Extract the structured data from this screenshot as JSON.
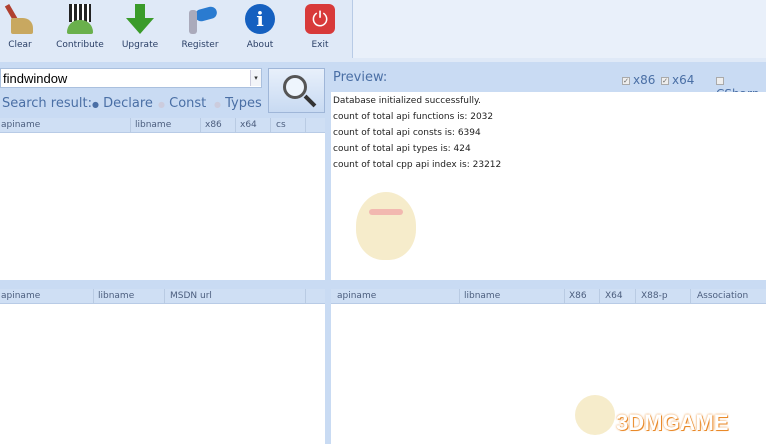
{
  "toolbar": {
    "buttons": [
      {
        "label": "Clear",
        "icon": "broom-icon"
      },
      {
        "label": "Contribute",
        "icon": "qr-android-icon"
      },
      {
        "label": "Upgrate",
        "icon": "download-arrow-icon"
      },
      {
        "label": "Register",
        "icon": "key-icon"
      },
      {
        "label": "About",
        "icon": "info-icon"
      },
      {
        "label": "Exit",
        "icon": "power-icon"
      }
    ]
  },
  "search": {
    "value": "findwindow",
    "result_label": "Search result:",
    "options": [
      "Declare",
      "Const",
      "Types"
    ],
    "selected": "Declare"
  },
  "top_table": {
    "columns": [
      "apiname",
      "libname",
      "x86",
      "x64",
      "cs"
    ]
  },
  "preview": {
    "title": "Preview:",
    "checks": [
      {
        "label": "x86",
        "checked": true
      },
      {
        "label": "x64",
        "checked": true
      },
      {
        "label": "CSharp",
        "checked": false
      }
    ],
    "lines": [
      "Database initialized successfully.",
      "count of total api functions is: 2032",
      "count of total api consts is: 6394",
      "count of total api types is: 424",
      "count of total cpp api index is: 23212"
    ]
  },
  "bottom_left_table": {
    "columns": [
      "apiname",
      "libname",
      "MSDN url"
    ]
  },
  "bottom_right_table": {
    "columns": [
      "apiname",
      "libname",
      "X86",
      "X64",
      "X88-p",
      "Association"
    ]
  },
  "watermark": "3DMGAME",
  "colors": {
    "toolbar": "#dfe9f7",
    "panel": "#c9dbf3",
    "accent": "#4a6fa5"
  }
}
